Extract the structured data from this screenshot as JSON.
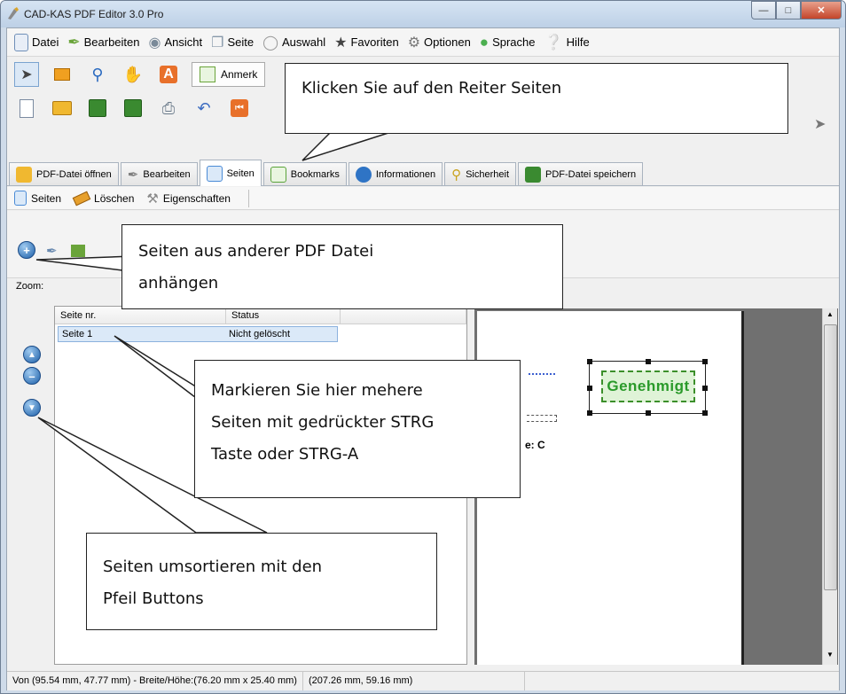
{
  "window": {
    "title": "CAD-KAS PDF Editor 3.0 Pro"
  },
  "menubar": [
    {
      "label": "Datei",
      "icon": "document-icon",
      "color": "#6fa0d8"
    },
    {
      "label": "Bearbeiten",
      "icon": "pen-icon",
      "color": "#6aa43a"
    },
    {
      "label": "Ansicht",
      "icon": "eye-icon",
      "color": "#7a8a99"
    },
    {
      "label": "Seite",
      "icon": "page-icon",
      "color": "#88a"
    },
    {
      "label": "Auswahl",
      "icon": "selection-icon",
      "color": "#999"
    },
    {
      "label": "Favoriten",
      "icon": "star-icon",
      "color": "#444"
    },
    {
      "label": "Optionen",
      "icon": "wrench-icon",
      "color": "#777"
    },
    {
      "label": "Sprache",
      "icon": "globe-icon",
      "color": "#4caf50"
    },
    {
      "label": "Hilfe",
      "icon": "help-icon",
      "color": "#2a6ac0"
    }
  ],
  "toolbar": {
    "annotation_label": "Anmerk"
  },
  "tabs": [
    {
      "label": "PDF-Datei öffnen",
      "icon": "folder-open-icon",
      "color": "#e6a419",
      "active": false
    },
    {
      "label": "Bearbeiten",
      "icon": "pen-icon",
      "color": "#7f7f7f",
      "active": false
    },
    {
      "label": "Seiten",
      "icon": "pages-icon",
      "color": "#4a8bd6",
      "active": true
    },
    {
      "label": "Bookmarks",
      "icon": "bookmark-icon",
      "color": "#5aa33a",
      "active": false
    },
    {
      "label": "Informationen",
      "icon": "info-icon",
      "color": "#2f74c5",
      "active": false
    },
    {
      "label": "Sicherheit",
      "icon": "key-icon",
      "color": "#c9a21b",
      "active": false
    },
    {
      "label": "PDF-Datei speichern",
      "icon": "save-icon",
      "color": "#3a8a30",
      "active": false
    }
  ],
  "subtoolbar": {
    "pages_label": "Seiten",
    "delete_label": "Löschen",
    "properties_label": "Eigenschaften"
  },
  "zoom": {
    "label": "Zoom:"
  },
  "pagelist": {
    "columns": [
      "Seite nr.",
      "Status"
    ],
    "rows": [
      {
        "page": "Seite 1",
        "status": "Nicht gelöscht"
      }
    ]
  },
  "preview": {
    "stamp_text": "Genehmigt",
    "fragment_text": "e: C"
  },
  "statusbar": {
    "selection": "Von (95.54 mm, 47.77 mm) - Breite/Höhe:(76.20 mm x 25.40 mm)",
    "cursor": "(207.26 mm, 59.16 mm)"
  },
  "callouts": {
    "tabs_hint": "Klicken Sie auf den Reiter Seiten",
    "append_hint_line1": "Seiten aus anderer PDF Datei",
    "append_hint_line2": "anhängen",
    "select_hint_line1": "Markieren Sie hier mehere",
    "select_hint_line2": "Seiten mit gedrückter STRG",
    "select_hint_line3": "Taste oder STRG-A",
    "sort_hint_line1": "Seiten umsortieren mit den",
    "sort_hint_line2": "Pfeil Buttons"
  }
}
